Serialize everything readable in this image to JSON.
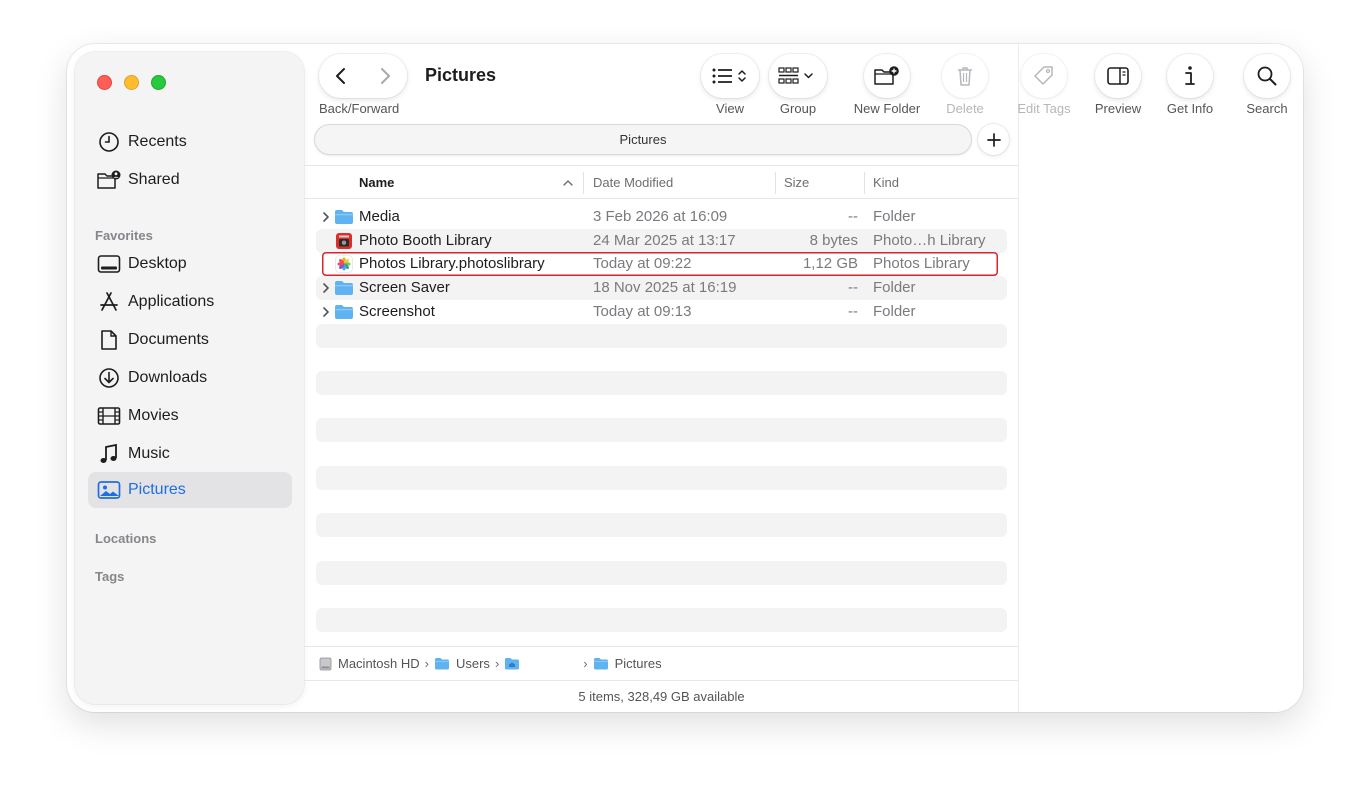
{
  "window": {
    "title": "Pictures"
  },
  "sidebar": {
    "top_items": [
      {
        "label": "Recents",
        "icon": "clock-icon"
      },
      {
        "label": "Shared",
        "icon": "shared-folder-icon"
      }
    ],
    "sections": {
      "favorites": "Favorites",
      "locations": "Locations",
      "tags": "Tags"
    },
    "favorites": [
      {
        "label": "Desktop",
        "icon": "desktop-icon"
      },
      {
        "label": "Applications",
        "icon": "applications-icon"
      },
      {
        "label": "Documents",
        "icon": "document-icon"
      },
      {
        "label": "Downloads",
        "icon": "download-icon"
      },
      {
        "label": "Movies",
        "icon": "film-icon"
      },
      {
        "label": "Music",
        "icon": "music-note-icon"
      },
      {
        "label": "Pictures",
        "icon": "photo-icon",
        "active": true
      }
    ]
  },
  "toolbar": {
    "nav_label": "Back/Forward",
    "title": "Pictures",
    "view_label": "View",
    "group_label": "Group",
    "new_folder_label": "New Folder",
    "delete_label": "Delete",
    "edit_tags_label": "Edit Tags",
    "preview_label": "Preview",
    "get_info_label": "Get Info",
    "search_label": "Search"
  },
  "pathbar": {
    "label": "Pictures"
  },
  "columns": {
    "name": "Name",
    "date": "Date Modified",
    "size": "Size",
    "kind": "Kind"
  },
  "files": [
    {
      "name": "Media",
      "date": "3 Feb 2026 at 16:09",
      "size": "--",
      "kind": "Folder",
      "icon": "folder-icon",
      "expandable": true
    },
    {
      "name": "Photo Booth Library",
      "date": "24 Mar 2025 at 13:17",
      "size": "8 bytes",
      "kind": "Photo…h Library",
      "icon": "photo-booth-icon",
      "expandable": false
    },
    {
      "name": "Photos Library.photoslibrary",
      "date": "Today at 09:22",
      "size": "1,12 GB",
      "kind": "Photos Library",
      "icon": "photos-app-icon",
      "expandable": false,
      "highlighted": true
    },
    {
      "name": "Screen Saver",
      "date": "18 Nov 2025 at 16:19",
      "size": "--",
      "kind": "Folder",
      "icon": "folder-icon",
      "expandable": true
    },
    {
      "name": "Screenshot",
      "date": "Today at 09:13",
      "size": "--",
      "kind": "Folder",
      "icon": "folder-icon",
      "expandable": true
    }
  ],
  "breadcrumb": {
    "disk": "Macintosh HD",
    "users": "Users",
    "home": "",
    "current": "Pictures"
  },
  "status": {
    "text": "5 items, 328,49 GB available"
  },
  "colors": {
    "accent": "#1f6fe0",
    "highlight_border": "#d8232a",
    "folder": "#5fb3f0"
  }
}
